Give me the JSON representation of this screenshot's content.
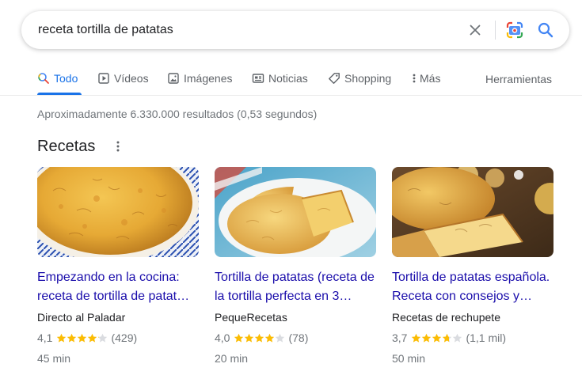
{
  "search": {
    "query": "receta tortilla de patatas"
  },
  "tabs": [
    {
      "label": "Todo",
      "icon": "search-icon",
      "active": true
    },
    {
      "label": "Vídeos",
      "icon": "video-icon",
      "active": false
    },
    {
      "label": "Imágenes",
      "icon": "image-icon",
      "active": false
    },
    {
      "label": "Noticias",
      "icon": "news-icon",
      "active": false
    },
    {
      "label": "Shopping",
      "icon": "tag-icon",
      "active": false
    },
    {
      "label": "Más",
      "icon": "more-vert-icon",
      "active": false
    }
  ],
  "tools_label": "Herramientas",
  "stats": "Aproximadamente 6.330.000 resultados (0,53 segundos)",
  "recipes": {
    "title": "Recetas",
    "cards": [
      {
        "title": "Empezando en la cocina: receta de tortilla de patat…",
        "source": "Directo al Paladar",
        "rating": "4,1",
        "stars": 4.1,
        "reviews": "(429)",
        "time": "45 min"
      },
      {
        "title": "Tortilla de patatas (receta de la tortilla perfecta en 3…",
        "source": "PequeRecetas",
        "rating": "4,0",
        "stars": 4.0,
        "reviews": "(78)",
        "time": "20 min"
      },
      {
        "title": "Tortilla de patatas española. Receta con consejos y…",
        "source": "Recetas de rechupete",
        "rating": "3,7",
        "stars": 3.7,
        "reviews": "(1,1 mil)",
        "time": "50 min"
      }
    ]
  },
  "colors": {
    "accent": "#1a73e8",
    "link": "#1a0dab",
    "star": "#fbbc04",
    "star_empty": "#dadce0"
  }
}
